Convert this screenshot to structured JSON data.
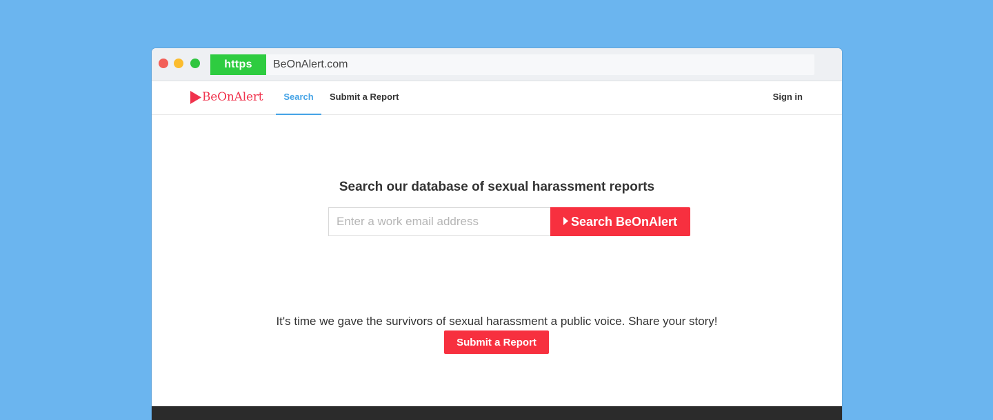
{
  "browser": {
    "scheme": "https",
    "domain": "BeOnAlert.com"
  },
  "nav": {
    "logo": "BeOnAlert",
    "links": [
      "Search",
      "Submit a Report"
    ],
    "active_link": "Search",
    "signin": "Sign in"
  },
  "main": {
    "headline": "Search our database of sexual harassment reports",
    "search_placeholder": "Enter a work email address",
    "search_button": "Search BeOnAlert",
    "tagline": "It's time we gave the survivors of sexual harassment a public voice. Share your story!",
    "report_button": "Submit a Report"
  },
  "colors": {
    "accent": "#f7303f",
    "link_active": "#45a3e6",
    "https_badge": "#2ecc40",
    "background": "#6bb5ef"
  },
  "icons": [
    "close-dot-icon",
    "minimize-dot-icon",
    "maximize-dot-icon",
    "play-triangle-icon",
    "caret-right-icon"
  ]
}
